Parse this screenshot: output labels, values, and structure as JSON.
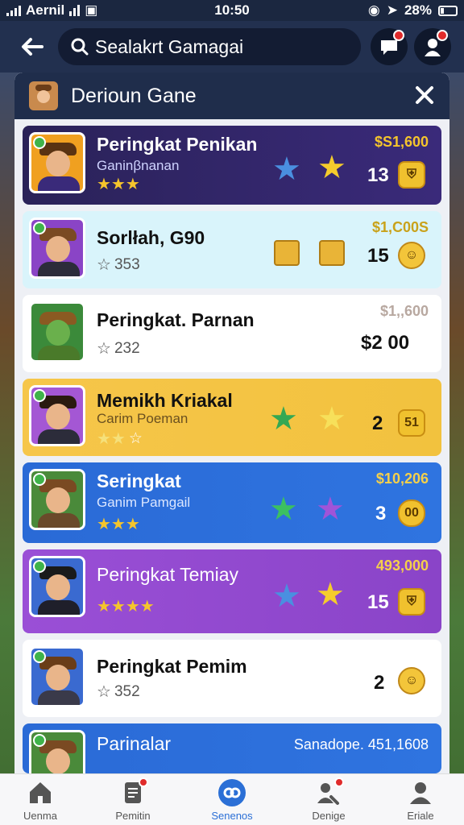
{
  "status": {
    "carrier": "Aernil",
    "time": "10:50",
    "battery": "28%"
  },
  "topbar": {
    "search_text": "Sealakrt Gamagai"
  },
  "panel": {
    "title": "Derioun Gane"
  },
  "rows": [
    {
      "title": "Peringkat Penikan",
      "subtitle": "Ganinβnanan",
      "stars": "★★★",
      "rating_num": "",
      "price": "$S1,600",
      "count": "13",
      "bg": "#2a2258"
    },
    {
      "title": "Sorlłah, G90",
      "subtitle": "",
      "stars": "☆",
      "rating_num": "353",
      "price": "$1,C00S",
      "count": "15",
      "bg": "#d9f4fb"
    },
    {
      "title": "Peringkat. Parnan",
      "subtitle": "",
      "stars": "☆",
      "rating_num": "232",
      "price": "$1,,600",
      "count": "$2 00",
      "bg": "#ffffff"
    },
    {
      "title": "Memikh Kriakal",
      "subtitle": "Carim Poeman",
      "stars": "★★",
      "rating_num": "☆",
      "price": "",
      "count": "2",
      "token": "51",
      "bg": "#f6c64a"
    },
    {
      "title": "Seringkat",
      "subtitle": "Ganim Pamgail",
      "stars": "★★★",
      "rating_num": "",
      "price": "$10,206",
      "count": "3",
      "token": "00",
      "bg": "#2a6ad6"
    },
    {
      "title": "Peringkat Temiay",
      "subtitle": "",
      "stars": "★★★★",
      "rating_num": "",
      "price": "493,000",
      "count": "15",
      "bg": "#9a4fd6"
    },
    {
      "title": "Peringkat Pemim",
      "subtitle": "",
      "stars": "☆",
      "rating_num": "352",
      "price": "",
      "count": "2",
      "bg": "#ffffff"
    },
    {
      "title": "Parinalar",
      "subtitle": "",
      "stars": "",
      "rating_num": "",
      "price": "Sanadope. 451,1608",
      "count": "",
      "bg": "#2a6ad6"
    }
  ],
  "nav": [
    {
      "label": "Uenma"
    },
    {
      "label": "Pemitin"
    },
    {
      "label": "Senenos"
    },
    {
      "label": "Denige"
    },
    {
      "label": "Eriale"
    }
  ]
}
